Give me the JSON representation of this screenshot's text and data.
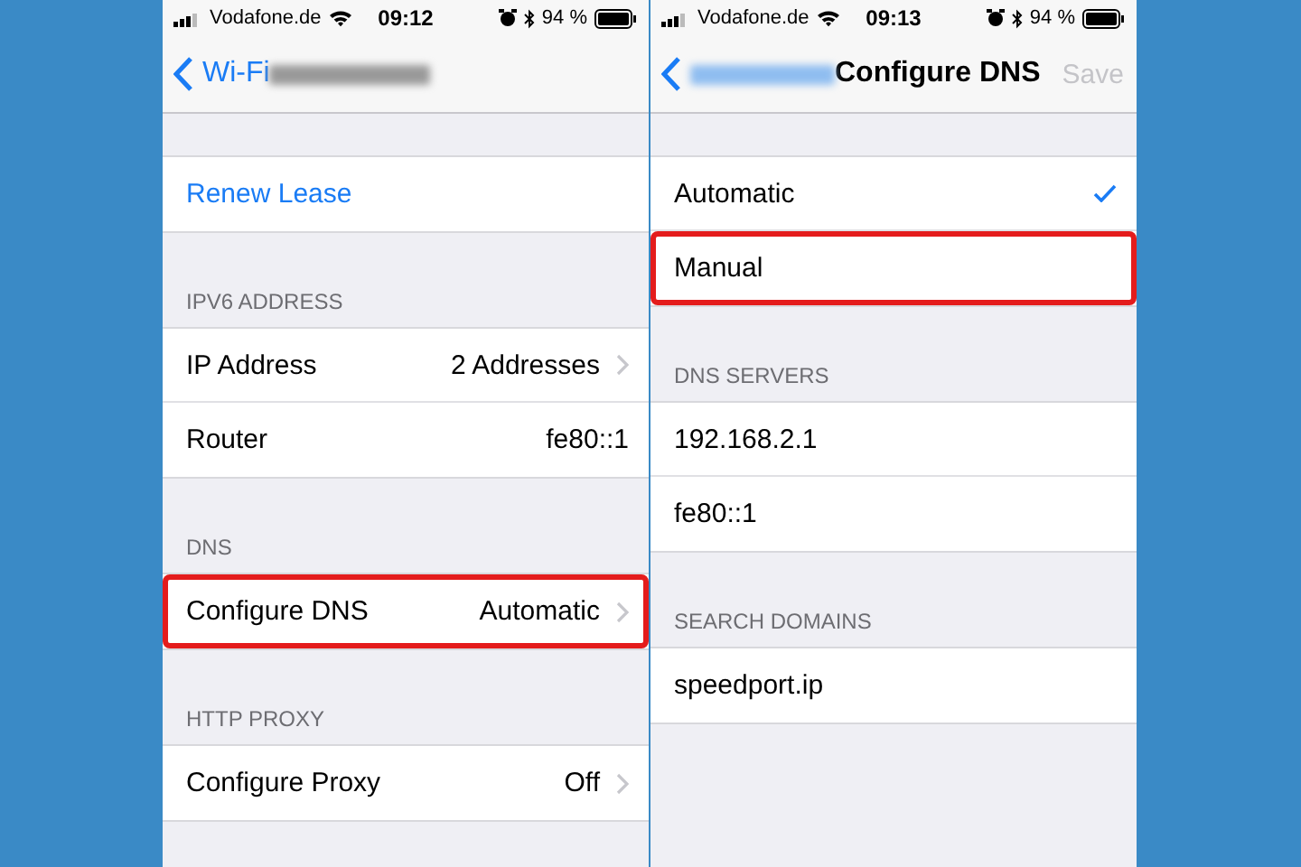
{
  "screens": [
    {
      "status": {
        "carrier": "Vodafone.de",
        "time": "09:12",
        "battery": "94 %"
      },
      "nav": {
        "back_label": "Wi-Fi"
      },
      "sections": [
        {
          "rows": [
            {
              "kind": "action",
              "label": "Renew Lease",
              "highlighted": false
            }
          ]
        },
        {
          "header": "IPV6 ADDRESS",
          "rows": [
            {
              "kind": "detail",
              "label": "IP Address",
              "value": "2 Addresses",
              "chevron": true,
              "highlighted": false
            },
            {
              "kind": "detail",
              "label": "Router",
              "value": "fe80::1",
              "chevron": false,
              "highlighted": false
            }
          ]
        },
        {
          "header": "DNS",
          "rows": [
            {
              "kind": "detail",
              "label": "Configure DNS",
              "value": "Automatic",
              "chevron": true,
              "highlighted": true
            }
          ]
        },
        {
          "header": "HTTP PROXY",
          "rows": [
            {
              "kind": "detail",
              "label": "Configure Proxy",
              "value": "Off",
              "chevron": true,
              "highlighted": false
            }
          ]
        }
      ]
    },
    {
      "status": {
        "carrier": "Vodafone.de",
        "time": "09:13",
        "battery": "94 %"
      },
      "nav": {
        "title": "Configure DNS",
        "action": {
          "label": "Save",
          "disabled": true
        }
      },
      "sections": [
        {
          "rows": [
            {
              "kind": "choice",
              "label": "Automatic",
              "checked": true,
              "highlighted": false
            },
            {
              "kind": "choice",
              "label": "Manual",
              "checked": false,
              "highlighted": true
            }
          ]
        },
        {
          "header": "DNS SERVERS",
          "rows": [
            {
              "kind": "detail",
              "label": "192.168.2.1",
              "chevron": false,
              "highlighted": false
            },
            {
              "kind": "detail",
              "label": "fe80::1",
              "chevron": false,
              "highlighted": false
            }
          ]
        },
        {
          "header": "SEARCH DOMAINS",
          "rows": [
            {
              "kind": "detail",
              "label": "speedport.ip",
              "chevron": false,
              "highlighted": false
            }
          ]
        }
      ]
    }
  ]
}
